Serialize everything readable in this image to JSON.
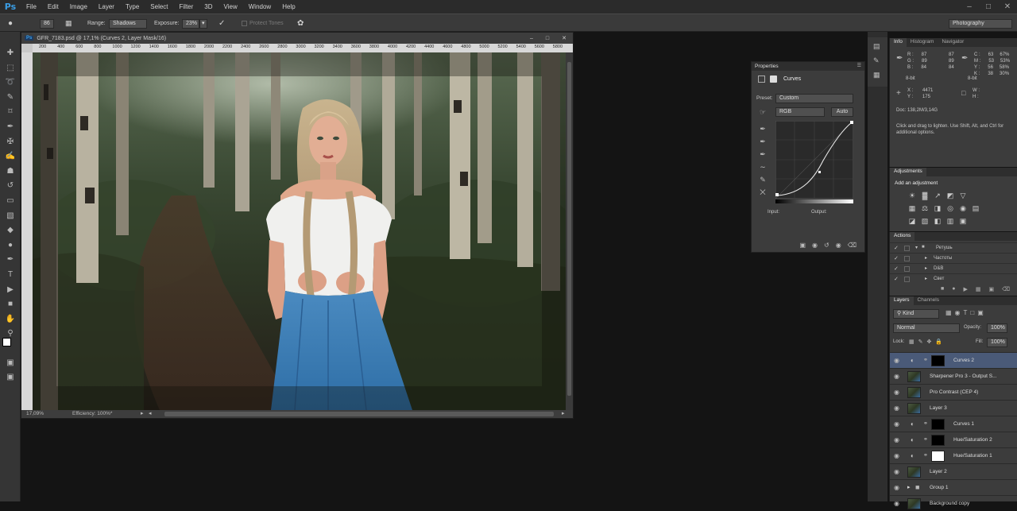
{
  "menubar": {
    "logo": "Ps",
    "items": [
      "File",
      "Edit",
      "Image",
      "Layer",
      "Type",
      "Select",
      "Filter",
      "3D",
      "View",
      "Window",
      "Help"
    ]
  },
  "options": {
    "brush_size": "86",
    "range_label": "Range:",
    "range_value": "Shadows",
    "exposure_label": "Exposure:",
    "exposure_value": "23%",
    "protect_tones": "Protect Tones",
    "workspace": "Photography"
  },
  "document": {
    "title": "GFR_7183.psd @ 17,1% (Curves 2, Layer Mask/16)",
    "tab_icon": "Ps",
    "ruler_ticks": [
      "200",
      "400",
      "600",
      "800",
      "1000",
      "1200",
      "1400",
      "1600",
      "1800",
      "2000",
      "2200",
      "2400",
      "2600",
      "2800",
      "3000",
      "3200",
      "3400",
      "3600",
      "3800",
      "4000",
      "4200",
      "4400",
      "4600",
      "4800",
      "5000",
      "5200",
      "5400",
      "5600",
      "5800"
    ],
    "zoom": "17,09%",
    "status": "Efficiency: 100%*"
  },
  "properties": {
    "title": "Properties",
    "adjustment": "Curves",
    "preset_label": "Preset:",
    "preset_value": "Custom",
    "channel": "RGB",
    "auto": "Auto",
    "input_label": "Input:",
    "output_label": "Output:"
  },
  "info": {
    "tabs": [
      "Info",
      "Histogram",
      "Navigator"
    ],
    "rgb_labels": [
      "R :",
      "G :",
      "B :"
    ],
    "rgb_vals1": [
      "87",
      "89",
      "84"
    ],
    "rgb_vals2": [
      "87",
      "89",
      "84"
    ],
    "cmyk_labels": [
      "C :",
      "M :",
      "Y :",
      "K :"
    ],
    "cmyk_vals1": [
      "63",
      "53",
      "56",
      "38"
    ],
    "cmyk_vals2": [
      "67%",
      "53%",
      "58%",
      "30%"
    ],
    "bit1": "8-bit",
    "bit2": "8-bit",
    "x_label": "X :",
    "x_val": "4471",
    "y_label": "Y :",
    "y_val": "175",
    "w_label": "W :",
    "h_label": "H :",
    "doc": "Doc: 138,2M/3,14G",
    "hint": "Click and drag to lighten. Use Shift, Alt, and Ctrl for additional options."
  },
  "adjustments": {
    "tab": "Adjustments",
    "add_label": "Add an adjustment"
  },
  "actions": {
    "tab": "Actions",
    "items": [
      {
        "label": "Ретушь",
        "folder": true,
        "open": true
      },
      {
        "label": "Частоты",
        "folder": false
      },
      {
        "label": "D&B",
        "folder": false
      },
      {
        "label": "Свет",
        "folder": false
      }
    ]
  },
  "layers": {
    "tabs": [
      "Layers",
      "Channels"
    ],
    "filter_kind": "Kind",
    "blend_mode": "Normal",
    "opacity_label": "Opacity:",
    "opacity_value": "100%",
    "lock_label": "Lock:",
    "fill_label": "Fill:",
    "fill_value": "100%",
    "items": [
      {
        "name": "Curves 2",
        "type": "adj",
        "mask": "black",
        "selected": true
      },
      {
        "name": "Sharpener Pro 3 - Output S...",
        "type": "photo"
      },
      {
        "name": "Pro Contrast (CEP 4)",
        "type": "photo"
      },
      {
        "name": "Layer 3",
        "type": "photo"
      },
      {
        "name": "Curves 1",
        "type": "adj",
        "mask": "black"
      },
      {
        "name": "Hue/Saturation 2",
        "type": "adj",
        "mask": "black"
      },
      {
        "name": "Hue/Saturation 1",
        "type": "adj",
        "mask": "white"
      },
      {
        "name": "Layer 2",
        "type": "photo"
      },
      {
        "name": "Group 1",
        "type": "group"
      },
      {
        "name": "Background copy",
        "type": "photo"
      }
    ]
  },
  "colors": {
    "accent": "#3b9ee6",
    "selected_layer": "#4a5a78"
  }
}
